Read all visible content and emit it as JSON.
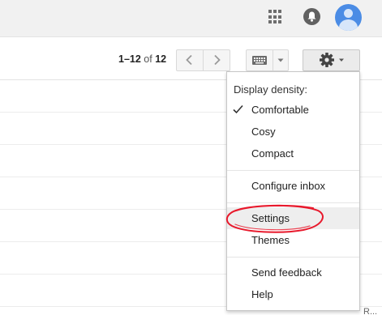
{
  "header": {
    "icons": [
      "apps-grid-icon",
      "notifications-bell-icon",
      "account-avatar-icon"
    ]
  },
  "toolbar": {
    "pager": {
      "range": "1–12",
      "of": "of",
      "total": "12"
    },
    "icons": [
      "chevron-left-icon",
      "chevron-right-icon",
      "keyboard-icon",
      "caret-down-icon",
      "gear-icon"
    ]
  },
  "settings_menu": {
    "heading": "Display density:",
    "density_options": [
      {
        "label": "Comfortable",
        "checked": true
      },
      {
        "label": "Cosy",
        "checked": false
      },
      {
        "label": "Compact",
        "checked": false
      }
    ],
    "items": [
      {
        "label": "Configure inbox"
      },
      {
        "label": "Settings",
        "highlighted": true
      },
      {
        "label": "Themes"
      },
      {
        "label": "Send feedback"
      },
      {
        "label": "Help"
      }
    ]
  },
  "partial_text": {
    "right_edge": "R..."
  },
  "colors": {
    "annotation": "#e8192c",
    "avatar": "#4b8ce5",
    "topbar": "#f1f1f1",
    "menu_highlight": "#eeeeee"
  }
}
